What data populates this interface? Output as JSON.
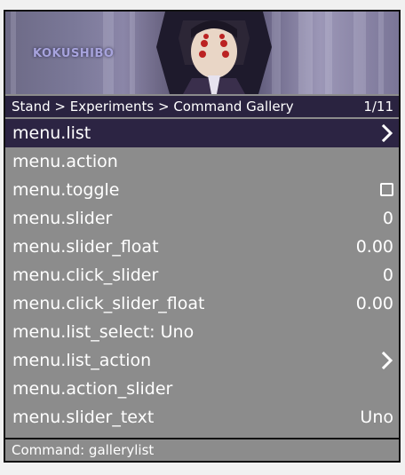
{
  "banner": {
    "logo_text": "KOKUSHIBO"
  },
  "breadcrumb": {
    "path": "Stand > Experiments > Command Gallery",
    "page_counter": "1/11"
  },
  "items": [
    {
      "label": "menu.list",
      "value": "",
      "icon": "chevron-right-icon"
    },
    {
      "label": "menu.action",
      "value": "",
      "icon": ""
    },
    {
      "label": "menu.toggle",
      "value": "",
      "icon": "checkbox-icon"
    },
    {
      "label": "menu.slider",
      "value": "0",
      "icon": ""
    },
    {
      "label": "menu.slider_float",
      "value": "0.00",
      "icon": ""
    },
    {
      "label": "menu.click_slider",
      "value": "0",
      "icon": ""
    },
    {
      "label": "menu.click_slider_float",
      "value": "0.00",
      "icon": ""
    },
    {
      "label": "menu.list_select: Uno",
      "value": "",
      "icon": ""
    },
    {
      "label": "menu.list_action",
      "value": "",
      "icon": "chevron-right-icon"
    },
    {
      "label": "menu.action_slider",
      "value": "",
      "icon": ""
    },
    {
      "label": "menu.slider_text",
      "value": "Uno",
      "icon": ""
    }
  ],
  "footer": {
    "command_text": "Command: gallerylist"
  },
  "colors": {
    "header_bar": "#2a2340",
    "focused_row": "#2c2443",
    "row_background": "#8c8c8c",
    "text": "#ffffff"
  }
}
